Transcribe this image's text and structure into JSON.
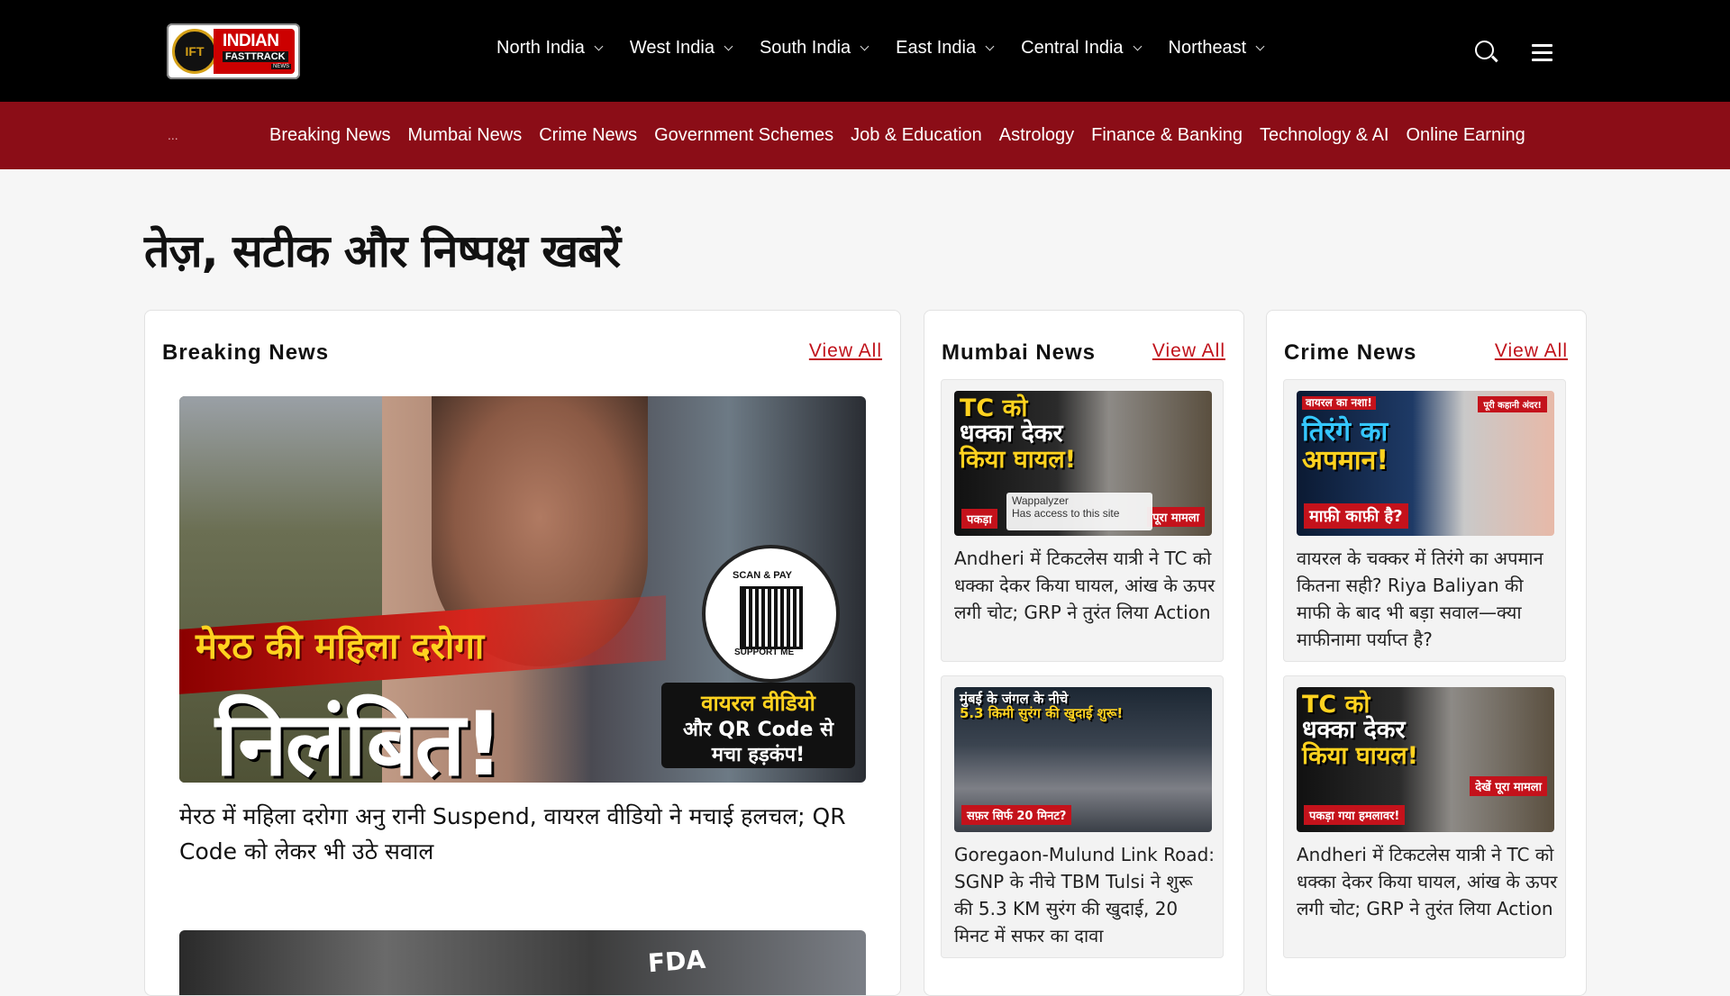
{
  "logo": {
    "crest": "IFT",
    "line1": "INDIAN",
    "line2": "FASTTRACK",
    "line3": "NEWS"
  },
  "regions": [
    "North India",
    "West India",
    "South India",
    "East India",
    "Central India",
    "Northeast"
  ],
  "categories": [
    "Breaking News",
    "Mumbai News",
    "Crime News",
    "Government Schemes",
    "Job & Education",
    "Astrology",
    "Finance & Banking",
    "Technology & AI",
    "Online Earning"
  ],
  "category_bar_more": "...",
  "tagline": "तेज़, सटीक और निष्पक्ष खबरें",
  "breaking": {
    "title": "Breaking News",
    "view_all": "View All",
    "hero_overlay_top": "मेरठ की महिला दरोगा",
    "hero_overlay_main": "निलंबित!",
    "hero_qr_top": "SCAN & PAY",
    "hero_qr_bottom": "SUPPORT ME",
    "hero_side_line1": "वायरल वीडियो",
    "hero_side_line2": "और QR Code से",
    "hero_side_line3": "मचा हड़कंप!",
    "hero_caption": "मेरठ में महिला दरोगा अनु रानी Suspend, वायरल वीडियो ने मचाई हलचल; QR Code को लेकर भी उठे सवाल",
    "second_overlay": "FDA"
  },
  "mumbai": {
    "title": "Mumbai News",
    "view_all": "View All",
    "items": [
      {
        "thumb_line1": "TC को",
        "thumb_line2": "धक्का देकर",
        "thumb_line3": "किया घायल!",
        "thumb_tag": "पकड़ा",
        "thumb_tag_right": "पूरा मामला",
        "text": "Andheri में टिकटलेस यात्री ने TC को धक्का देकर किया घायल, आंख के ऊपर लगी चोट; GRP ने तुरंत लिया Action"
      },
      {
        "thumb_line1": "मुंबई के जंगल के नीचे",
        "thumb_line2": "5.3 किमी सुरंग की खुदाई शुरू!",
        "thumb_tag": "सफ़र सिर्फ 20 मिनट?",
        "text": "Goregaon-Mulund Link Road: SGNP के नीचे TBM Tulsi ने शुरू की 5.3 KM सुरंग की खुदाई, 20 मिनट में सफर का दावा"
      }
    ]
  },
  "crime": {
    "title": "Crime News",
    "view_all": "View All",
    "items": [
      {
        "thumb_top": "वायरल का नशा!",
        "thumb_line1": "तिरंगे का",
        "thumb_line2": "अपमान!",
        "thumb_tag": "माफ़ी काफ़ी है?",
        "thumb_tag_right": "पूरी कहानी अंदर!",
        "text": "वायरल के चक्कर में तिरंगे का अपमान कितना सही? Riya Baliyan की माफी के बाद भी बड़ा सवाल—क्या माफीनामा पर्याप्त है?"
      },
      {
        "thumb_line1": "TC को",
        "thumb_line2": "धक्का देकर",
        "thumb_line3": "किया घायल!",
        "thumb_tag": "पकड़ा गया हमलावर!",
        "thumb_tag_right": "देखें पूरा मामला",
        "text": "Andheri में टिकटलेस यात्री ने TC को धक्का देकर किया घायल, आंख के ऊपर लगी चोट; GRP ने तुरंत लिया Action"
      }
    ]
  },
  "overlay_popup": {
    "title": "Wappalyzer",
    "subtitle": "Has access to this site"
  },
  "icons": {
    "search": "search-icon",
    "menu": "hamburger-menu-icon"
  },
  "colors": {
    "topbar": "#000000",
    "catbar": "#8b0d17",
    "accent": "#c0111a"
  }
}
